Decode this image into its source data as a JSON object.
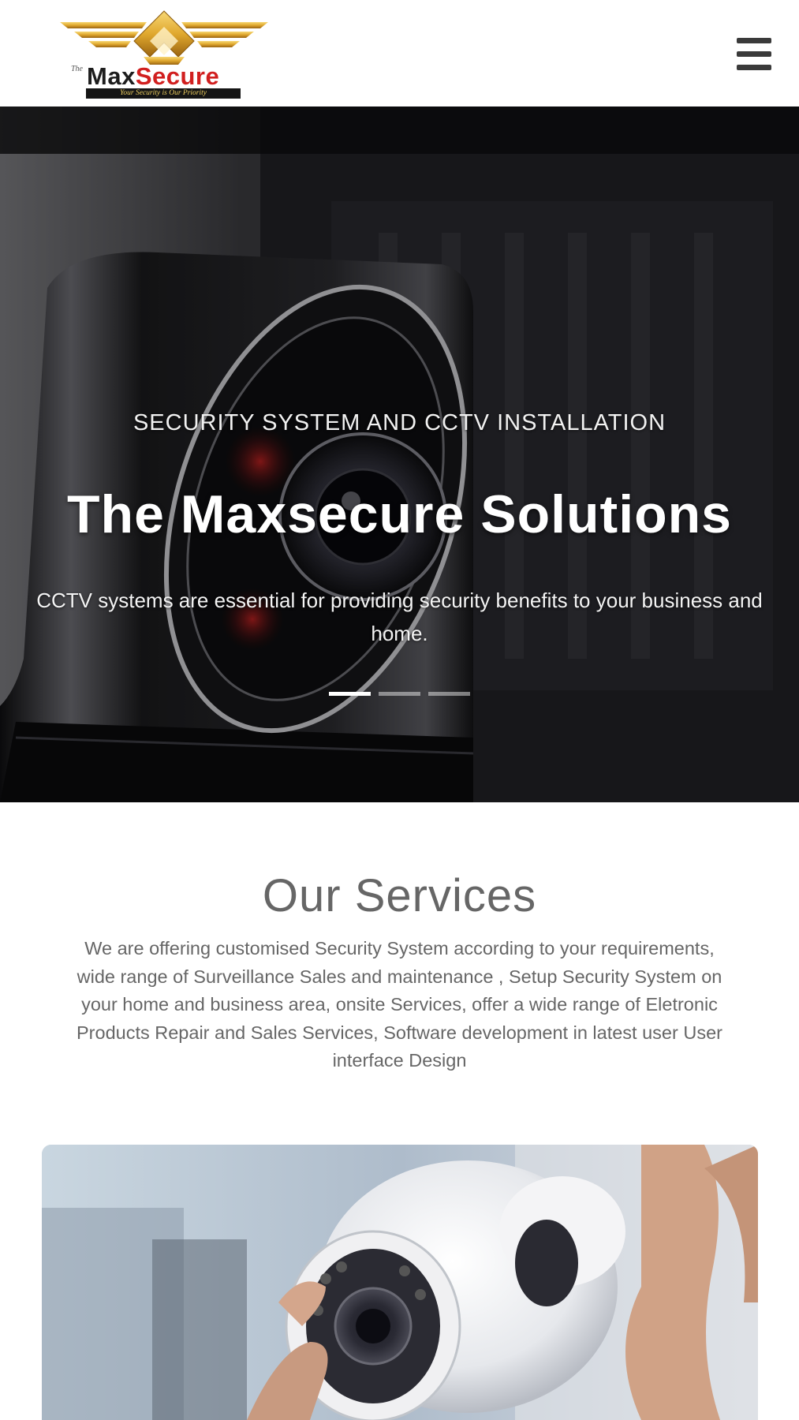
{
  "header": {
    "logo": {
      "prefix": "The",
      "name_part1": "Max",
      "name_part2": "Secure",
      "tagline": "Your Security is Our Priority"
    },
    "menu_icon": "hamburger-icon"
  },
  "hero": {
    "subtitle": "SECURITY SYSTEM AND CCTV INSTALLATION",
    "title": "The Maxsecure Solutions",
    "description": "CCTV systems are essential for providing security benefits to your business and home.",
    "slides": [
      {
        "active": true
      },
      {
        "active": false
      },
      {
        "active": false
      }
    ]
  },
  "services": {
    "title": "Our Services",
    "description": "We are offering customised Security System according to your requirements, wide range of Surveillance Sales and maintenance , Setup Security System on your home and business area, onsite Services, offer a wide range of Eletronic Products Repair and Sales Services, Software development in latest user User interface Design"
  },
  "colors": {
    "logo_gold": "#e0a82e",
    "logo_red": "#d11f1f",
    "text_gray": "#666666",
    "hero_dark": "#121214"
  }
}
